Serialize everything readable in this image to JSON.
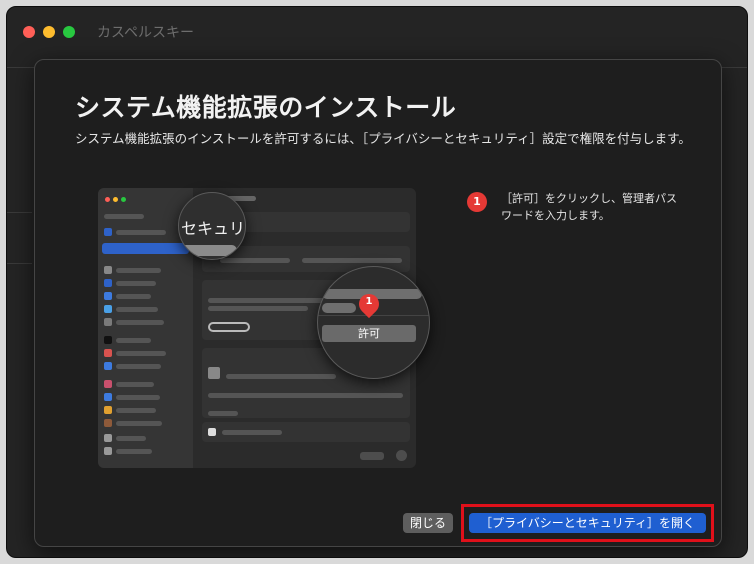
{
  "window": {
    "title": "カスペルスキー"
  },
  "dialog": {
    "title": "システム機能拡張のインストール",
    "description": "システム機能拡張のインストールを許可するには、［プライバシーとセキュリティ］設定で権限を付与します。"
  },
  "illustration": {
    "magnifier_label": "セキュリ",
    "pin_number": "1",
    "allow_button_label": "許可"
  },
  "steps": [
    {
      "number": "1",
      "text": "［許可］をクリックし、管理者パスワードを入力します。"
    }
  ],
  "buttons": {
    "close_label": "閉じる",
    "open_label": "［プライバシーとセキュリティ］を開く"
  },
  "colors": {
    "accent_blue": "#1f5fd1",
    "highlight_red": "#e0101a",
    "badge_red": "#e53935"
  }
}
